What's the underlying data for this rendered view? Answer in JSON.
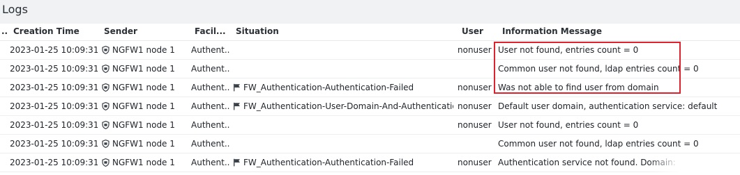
{
  "panel": {
    "title": "Logs"
  },
  "columns": {
    "dot": "..",
    "creation_time": "Creation Time",
    "sender": "Sender",
    "facility": "Facil...",
    "situation": "Situation",
    "user": "User",
    "info": "Information Message"
  },
  "rows": [
    {
      "time": "2023-01-25 10:09:31",
      "sender": "NGFW1 node 1",
      "facility": "Authent...",
      "situation": "",
      "user": "nonuser",
      "info": "User not found, entries count = 0"
    },
    {
      "time": "2023-01-25 10:09:31",
      "sender": "NGFW1 node 1",
      "facility": "Authent...",
      "situation": "",
      "user": "",
      "info": "Common user not found, ldap entries count = 0"
    },
    {
      "time": "2023-01-25 10:09:31",
      "sender": "NGFW1 node 1",
      "facility": "Authent...",
      "situation": "FW_Authentication-Authentication-Failed",
      "user": "nonuser",
      "info": "Was not able to find user from domain"
    },
    {
      "time": "2023-01-25 10:09:31",
      "sender": "NGFW1 node 1",
      "facility": "Authent...",
      "situation": "FW_Authentication-User-Domain-And-Authentication-S...",
      "user": "nonuser",
      "info": "Default user domain, authentication service: default"
    },
    {
      "time": "2023-01-25 10:09:31",
      "sender": "NGFW1 node 1",
      "facility": "Authent...",
      "situation": "",
      "user": "nonuser",
      "info": "User not found, entries count = 0"
    },
    {
      "time": "2023-01-25 10:09:31",
      "sender": "NGFW1 node 1",
      "facility": "Authent...",
      "situation": "",
      "user": "",
      "info": "Common user not found, ldap entries count = 0"
    },
    {
      "time": "2023-01-25 10:09:31",
      "sender": "NGFW1 node 1",
      "facility": "Authent...",
      "situation": "FW_Authentication-Authentication-Failed",
      "user": "nonuser",
      "info": "Authentication service not found. Domain:"
    }
  ],
  "icons": {
    "sender": "shield-node-icon",
    "situation": "flag-icon"
  },
  "colors": {
    "highlight": "#e0202a"
  }
}
